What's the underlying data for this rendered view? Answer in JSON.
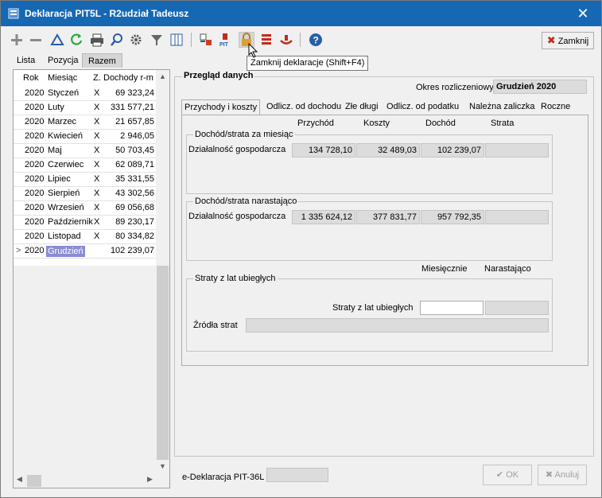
{
  "window": {
    "title": "Deklaracja PIT5L - R2udział Tadeusz",
    "close_glyph": "✕"
  },
  "toolbar": {
    "icons": [
      "plus-icon",
      "minus-icon",
      "triangle-icon",
      "refresh-icon",
      "print-icon",
      "search-icon",
      "gear-icon",
      "filter-icon",
      "columns-icon",
      "grid-pit-icon",
      "pit-icon",
      "lock-icon",
      "stack-icon",
      "pit-red-icon",
      "help-icon"
    ],
    "close_label": "Zamknij"
  },
  "tooltip": "Zamknij deklaracje (Shift+F4)",
  "tabs": [
    "Lista",
    "Pozycja",
    "Razem"
  ],
  "left_grid": {
    "headers": [
      "Rok",
      "Miesiąc",
      "Z.",
      "Dochody r-m"
    ],
    "rows": [
      {
        "year": "2020",
        "month": "Styczeń",
        "z": "X",
        "value": "69 323,24"
      },
      {
        "year": "2020",
        "month": "Luty",
        "z": "X",
        "value": "331 577,21"
      },
      {
        "year": "2020",
        "month": "Marzec",
        "z": "X",
        "value": "21 657,85"
      },
      {
        "year": "2020",
        "month": "Kwiecień",
        "z": "X",
        "value": "2 946,05"
      },
      {
        "year": "2020",
        "month": "Maj",
        "z": "X",
        "value": "50 703,45"
      },
      {
        "year": "2020",
        "month": "Czerwiec",
        "z": "X",
        "value": "62 089,71"
      },
      {
        "year": "2020",
        "month": "Lipiec",
        "z": "X",
        "value": "35 331,55"
      },
      {
        "year": "2020",
        "month": "Sierpień",
        "z": "X",
        "value": "43 302,56"
      },
      {
        "year": "2020",
        "month": "Wrzesień",
        "z": "X",
        "value": "69 056,68"
      },
      {
        "year": "2020",
        "month": "Październik",
        "z": "X",
        "value": "89 230,17"
      },
      {
        "year": "2020",
        "month": "Listopad",
        "z": "X",
        "value": "80 334,82"
      },
      {
        "year": "2020",
        "month": "Grudzień",
        "z": "",
        "value": "102 239,07"
      }
    ]
  },
  "right": {
    "title": "Przegląd danych",
    "okres_label": "Okres rozliczeniowy",
    "okres_value": "Grudzień 2020",
    "inner_tabs": [
      "Przychody i koszty",
      "Odlicz. od dochodu",
      "Złe długi",
      "Odlicz. od podatku",
      "Należna zaliczka",
      "Roczne"
    ],
    "columns": [
      "Przychód",
      "Koszty",
      "Dochód",
      "Strata"
    ],
    "group1": {
      "title": "Dochód/strata za miesiąc",
      "label": "Działalność gospodarcza",
      "values": [
        "134 728,10",
        "32 489,03",
        "102 239,07",
        ""
      ]
    },
    "group2": {
      "title": "Dochód/strata narastająco",
      "label": "Działalność gospodarcza",
      "values": [
        "1 335 624,12",
        "377 831,77",
        "957 792,35",
        ""
      ]
    },
    "straty_columns": [
      "Miesięcznie",
      "Narastająco"
    ],
    "group3": {
      "title": "Straty z lat ubiegłych",
      "straty_label": "Straty z lat ubiegłych",
      "zrodla_label": "Źródła strat"
    },
    "edek_label": "e-Deklaracja PIT-36L",
    "ok_label": "OK",
    "cancel_label": "Anuluj"
  }
}
